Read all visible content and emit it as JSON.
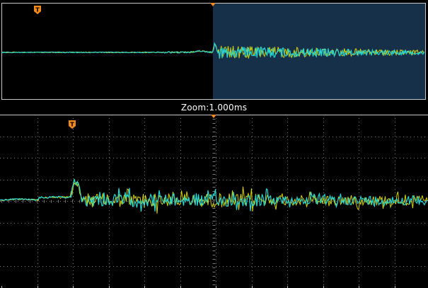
{
  "zoom_label": "Zoom:1.000ms",
  "trigger_marker_text": "T",
  "colors": {
    "background": "#000000",
    "trace_primary": "#27d7d3",
    "trace_secondary": "#d8d400",
    "trigger_marker": "#f08a1c",
    "zoom_window": "#163049",
    "frame": "#c8c8c8",
    "grid": "#7a7a7a"
  },
  "icons": {
    "trigger_marker": "trigger-T-marker-icon",
    "center_marker": "triangle-down-icon"
  }
}
